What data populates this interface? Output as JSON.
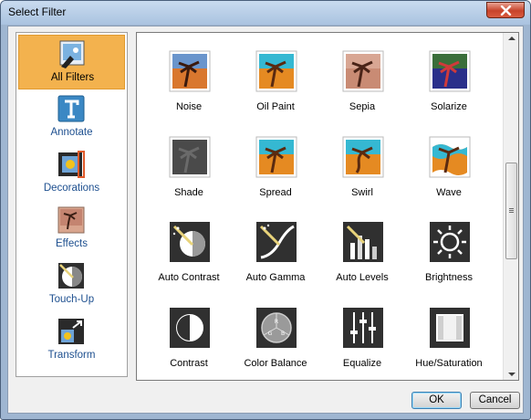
{
  "window": {
    "title": "Select Filter"
  },
  "sidebar": {
    "items": [
      {
        "label": "All Filters",
        "icon": "all-filters-icon"
      },
      {
        "label": "Annotate",
        "icon": "text-t-icon"
      },
      {
        "label": "Decorations",
        "icon": "decorations-icon"
      },
      {
        "label": "Effects",
        "icon": "effects-icon"
      },
      {
        "label": "Touch-Up",
        "icon": "touch-up-icon"
      },
      {
        "label": "Transform",
        "icon": "transform-icon"
      }
    ],
    "selected": "All Filters"
  },
  "gallery": {
    "filters": [
      {
        "label": "Noise"
      },
      {
        "label": "Oil Paint"
      },
      {
        "label": "Sepia"
      },
      {
        "label": "Solarize"
      },
      {
        "label": "Shade"
      },
      {
        "label": "Spread"
      },
      {
        "label": "Swirl"
      },
      {
        "label": "Wave"
      },
      {
        "label": "Auto Contrast"
      },
      {
        "label": "Auto Gamma"
      },
      {
        "label": "Auto Levels"
      },
      {
        "label": "Brightness"
      },
      {
        "label": "Contrast"
      },
      {
        "label": "Color Balance"
      },
      {
        "label": "Equalize"
      },
      {
        "label": "Hue/Saturation"
      }
    ]
  },
  "buttons": {
    "ok": "OK",
    "cancel": "Cancel"
  },
  "colors": {
    "selection": "#f3b24e",
    "link_text": "#1d4f8f"
  }
}
